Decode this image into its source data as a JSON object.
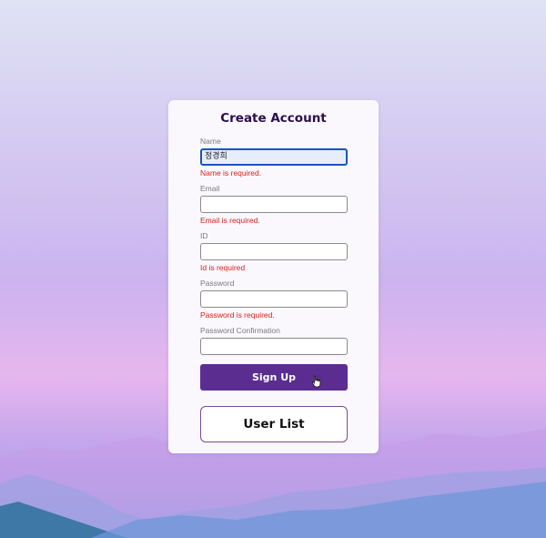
{
  "form": {
    "title": "Create Account",
    "fields": [
      {
        "label": "Name",
        "value": "정경희",
        "error": "Name is required."
      },
      {
        "label": "Email",
        "value": "",
        "error": "Email is required."
      },
      {
        "label": "ID",
        "value": "",
        "error": "Id is required"
      },
      {
        "label": "Password",
        "value": "",
        "error": "Password is required."
      },
      {
        "label": "Password Confirmation",
        "value": "",
        "error": ""
      }
    ],
    "signup_label": "Sign Up",
    "userlist_label": "User List"
  },
  "colors": {
    "primary": "#5b2d91",
    "error": "#d9201d",
    "focus": "#1a55b8"
  },
  "icons": {
    "cursor": "hand-pointer-icon"
  }
}
